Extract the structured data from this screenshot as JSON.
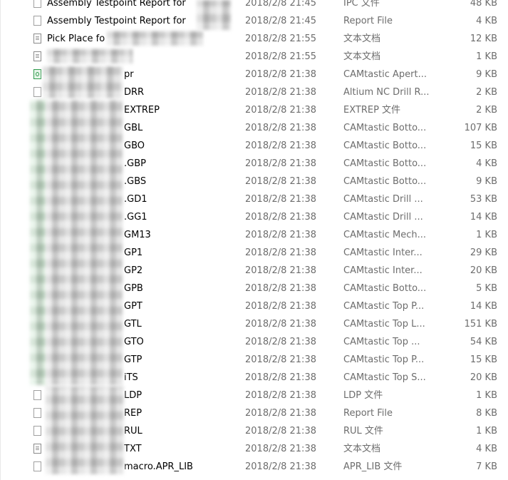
{
  "files": [
    {
      "name": "Assembly Testpoint Report for",
      "date": "2018/2/8 21:45",
      "type": "IPC 文件",
      "size": "48 KB",
      "icon": "document-icon"
    },
    {
      "name": "Assembly Testpoint Report for",
      "date": "2018/2/8 21:45",
      "type": "Report File",
      "size": "4 KB",
      "icon": "document-icon"
    },
    {
      "name": "Pick Place fo",
      "date": "2018/2/8 21:55",
      "type": "文本文档",
      "size": "12 KB",
      "icon": "text-document-icon"
    },
    {
      "name": "",
      "date": "2018/2/8 21:55",
      "type": "文本文档",
      "size": "1 KB",
      "icon": "text-document-icon"
    },
    {
      "name": "pr",
      "date": "2018/2/8 21:38",
      "type": "CAMtastic Apert...",
      "size": "9 KB",
      "icon": "camtastic-file-icon"
    },
    {
      "name": "DRR",
      "date": "2018/2/8 21:38",
      "type": "Altium NC Drill R...",
      "size": "2 KB",
      "icon": "document-icon"
    },
    {
      "name": "EXTREP",
      "date": "2018/2/8 21:38",
      "type": "EXTREP 文件",
      "size": "2 KB",
      "icon": "document-icon"
    },
    {
      "name": "GBL",
      "date": "2018/2/8 21:38",
      "type": "CAMtastic Botto...",
      "size": "107 KB",
      "icon": "camtastic-file-icon"
    },
    {
      "name": "GBO",
      "date": "2018/2/8 21:38",
      "type": "CAMtastic Botto...",
      "size": "15 KB",
      "icon": "camtastic-file-icon"
    },
    {
      "name": ".GBP",
      "date": "2018/2/8 21:38",
      "type": "CAMtastic Botto...",
      "size": "4 KB",
      "icon": "camtastic-file-icon"
    },
    {
      "name": ".GBS",
      "date": "2018/2/8 21:38",
      "type": "CAMtastic Botto...",
      "size": "9 KB",
      "icon": "camtastic-file-icon"
    },
    {
      "name": ".GD1",
      "date": "2018/2/8 21:38",
      "type": "CAMtastic Drill ...",
      "size": "53 KB",
      "icon": "camtastic-file-icon"
    },
    {
      "name": ".GG1",
      "date": "2018/2/8 21:38",
      "type": "CAMtastic Drill ...",
      "size": "14 KB",
      "icon": "camtastic-file-icon"
    },
    {
      "name": "GM13",
      "date": "2018/2/8 21:38",
      "type": "CAMtastic Mech...",
      "size": "1 KB",
      "icon": "camtastic-file-icon"
    },
    {
      "name": "GP1",
      "date": "2018/2/8 21:38",
      "type": "CAMtastic Inter...",
      "size": "29 KB",
      "icon": "camtastic-file-icon"
    },
    {
      "name": "GP2",
      "date": "2018/2/8 21:38",
      "type": "CAMtastic Inter...",
      "size": "20 KB",
      "icon": "camtastic-file-icon"
    },
    {
      "name": "GPB",
      "date": "2018/2/8 21:38",
      "type": "CAMtastic Botto...",
      "size": "5 KB",
      "icon": "camtastic-file-icon"
    },
    {
      "name": "GPT",
      "date": "2018/2/8 21:38",
      "type": "CAMtastic Top P...",
      "size": "14 KB",
      "icon": "camtastic-file-icon"
    },
    {
      "name": "GTL",
      "date": "2018/2/8 21:38",
      "type": "CAMtastic Top L...",
      "size": "151 KB",
      "icon": "camtastic-file-icon"
    },
    {
      "name": "GTO",
      "date": "2018/2/8 21:38",
      "type": "CAMtastic Top ...",
      "size": "54 KB",
      "icon": "camtastic-file-icon"
    },
    {
      "name": "GTP",
      "date": "2018/2/8 21:38",
      "type": "CAMtastic Top P...",
      "size": "15 KB",
      "icon": "camtastic-file-icon"
    },
    {
      "name": "iTS",
      "date": "2018/2/8 21:38",
      "type": "CAMtastic Top S...",
      "size": "20 KB",
      "icon": "camtastic-file-icon"
    },
    {
      "name": "LDP",
      "date": "2018/2/8 21:38",
      "type": "LDP 文件",
      "size": "1 KB",
      "icon": "document-icon"
    },
    {
      "name": "REP",
      "date": "2018/2/8 21:38",
      "type": "Report File",
      "size": "8 KB",
      "icon": "document-icon"
    },
    {
      "name": "RUL",
      "date": "2018/2/8 21:38",
      "type": "RUL 文件",
      "size": "1 KB",
      "icon": "document-icon"
    },
    {
      "name": "TXT",
      "date": "2018/2/8 21:38",
      "type": "文本文档",
      "size": "4 KB",
      "icon": "text-document-icon"
    },
    {
      "name": "macro.APR_LIB",
      "date": "2018/2/8 21:38",
      "type": "APR_LIB 文件",
      "size": "7 KB",
      "icon": "document-icon"
    }
  ]
}
